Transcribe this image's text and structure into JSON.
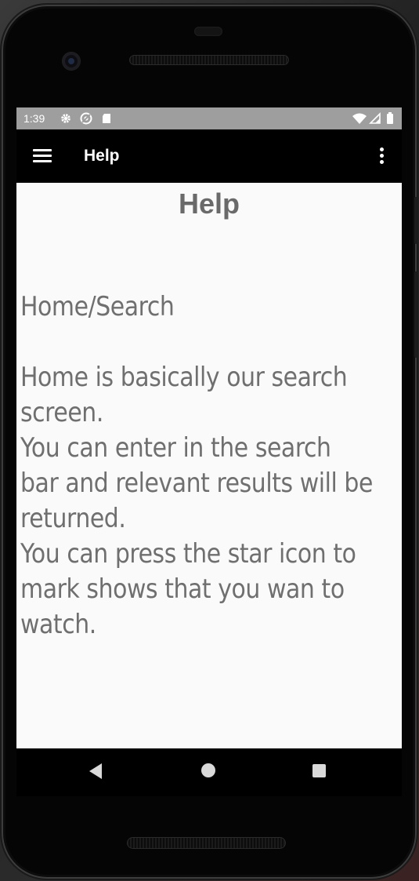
{
  "status_bar": {
    "time": "1:39",
    "left_icons": [
      "gear-icon",
      "sync-icon",
      "sd-card-icon"
    ],
    "right_icons": [
      "wifi-icon",
      "signal-icon",
      "battery-icon"
    ]
  },
  "app_bar": {
    "title": "Help",
    "menu_icon": "hamburger-menu-icon",
    "overflow_icon": "more-vert-icon"
  },
  "content": {
    "page_title": "Help",
    "section_title": "Home/Search",
    "body": "Home is basically our search\nscreen.\nYou can enter in the search\nbar and relevant results will be\nreturned.\nYou can press the star icon to\nmark shows that you wan to\nwatch."
  },
  "nav_bar": {
    "buttons": [
      "back-icon",
      "home-icon",
      "recents-icon"
    ]
  },
  "colors": {
    "status_bar": "#9e9e9e",
    "app_bar": "#000000",
    "content_bg": "#fafafa",
    "text": "#6f6f6f"
  }
}
